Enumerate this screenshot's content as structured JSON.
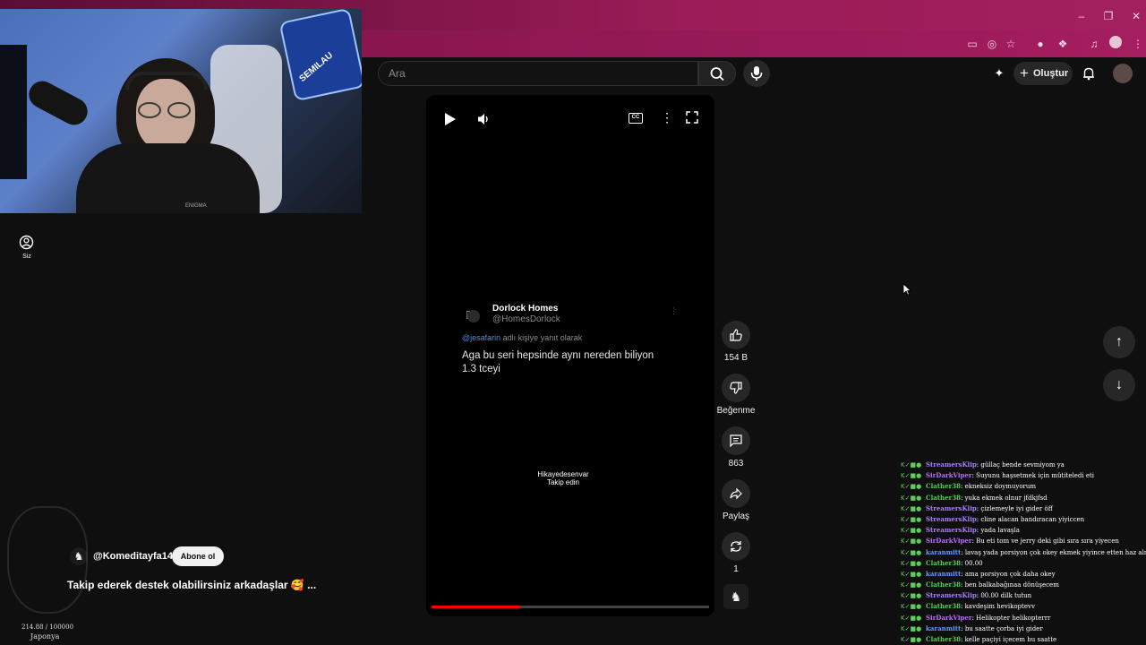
{
  "search": {
    "placeholder": "Ara"
  },
  "header": {
    "create_label": "Oluştur"
  },
  "sidebar": {
    "you_label": "Siz"
  },
  "webcam": {
    "banner_text": "SEMILAU",
    "shirt_text": "ENIGMA"
  },
  "player": {
    "tweet": {
      "name": "Dorlock Homes",
      "handle": "@HomesDorlock",
      "reply_user": "@jesafarin",
      "reply_suffix": "adlı kişiye yanıt olarak",
      "text_line1": "Aga bu seri hepsinde aynı nereden biliyon",
      "text_line2": "1.3 tceyi"
    },
    "caption_line1": "Hikayedesenvar",
    "caption_line2": "Takip edin",
    "progress": 0.32
  },
  "actions": {
    "likes": "154 B",
    "dislike_label": "Beğenme",
    "comments": "863",
    "share_label": "Paylaş",
    "remix_count": "1"
  },
  "channel": {
    "handle": "@Komeditayfa14",
    "subscribe_label": "Abone ol",
    "description": "Takip ederek destek olabilirsiniz arkadaşlar 🥰 ..."
  },
  "overlay": {
    "score": "214.88 / 100000",
    "location": "Japonya"
  },
  "chat": [
    {
      "user": "StreamersKlip",
      "color": "#a97dff",
      "msg": ": güllaç bende sevmiyom ya"
    },
    {
      "user": "SirDarkViper",
      "color": "#b76cff",
      "msg": ": Suyunu haşsetmek için mütiteledi eti"
    },
    {
      "user": "Clather38",
      "color": "#4fd14f",
      "msg": ": ekneksiz doymuyorum"
    },
    {
      "user": "Clather38",
      "color": "#4fd14f",
      "msg": ": yuka ekmek olnur jfdkjfsd"
    },
    {
      "user": "StreamersKlip",
      "color": "#a97dff",
      "msg": ": çizlemeyle iyi gider öff"
    },
    {
      "user": "StreamersKlip",
      "color": "#a97dff",
      "msg": ": cline alacan bandıracan yiyiccen"
    },
    {
      "user": "StreamersKlip",
      "color": "#a97dff",
      "msg": ": yada lavaşla"
    },
    {
      "user": "SirDarkViper",
      "color": "#b76cff",
      "msg": ": Bu eti tom ve jerry deki gibi sıra sıra yiyecen"
    },
    {
      "user": "karanmitt",
      "color": "#5a9dff",
      "msg": ": lavaş yada porsiyon çok okey ekmek yiyince etten haz almıyorum"
    },
    {
      "user": "Clather38",
      "color": "#4fd14f",
      "msg": ": 00.00"
    },
    {
      "user": "karanmitt",
      "color": "#5a9dff",
      "msg": ": ama porsiyon çok daha okey"
    },
    {
      "user": "Clather38",
      "color": "#4fd14f",
      "msg": ": ben balkabağınaa dönüşecem"
    },
    {
      "user": "StreamersKlip",
      "color": "#a97dff",
      "msg": ": 00.00 dilk tutun"
    },
    {
      "user": "Clather38",
      "color": "#4fd14f",
      "msg": ": kavdeşim hevikoptevv"
    },
    {
      "user": "SirDarkViper",
      "color": "#b76cff",
      "msg": ": Helikopter helikopterrr"
    },
    {
      "user": "karanmitt",
      "color": "#5a9dff",
      "msg": ": bu saatte çorba iyi gider"
    },
    {
      "user": "Clather38",
      "color": "#4fd14f",
      "msg": ": kelle paçiyi içecem bu saatte"
    }
  ]
}
